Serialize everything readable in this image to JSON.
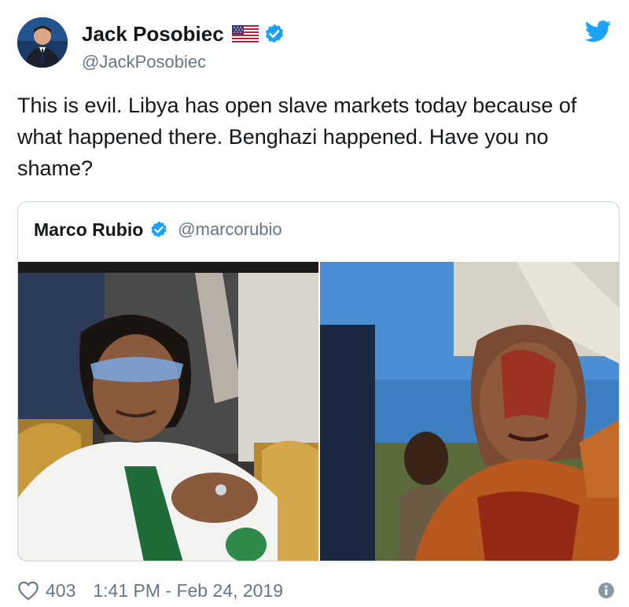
{
  "tweet": {
    "display_name": "Jack Posobiec",
    "handle": "@JackPosobiec",
    "text": "This is evil. Libya has open slave markets today because of what happened there. Benghazi happened. Have you no shame?",
    "like_count": "403",
    "timestamp": "1:41 PM - Feb 24, 2019"
  },
  "quoted_tweet": {
    "display_name": "Marco Rubio",
    "handle": "@marcorubio"
  },
  "icons": {
    "flag": "us-flag-icon",
    "verified": "verified-badge-icon",
    "brand": "twitter-bird-icon",
    "like": "heart-icon",
    "info": "info-icon"
  },
  "colors": {
    "brand_blue": "#1da1f2",
    "text_primary": "#14171a",
    "text_secondary": "#657786",
    "border": "#ccd6dd"
  }
}
